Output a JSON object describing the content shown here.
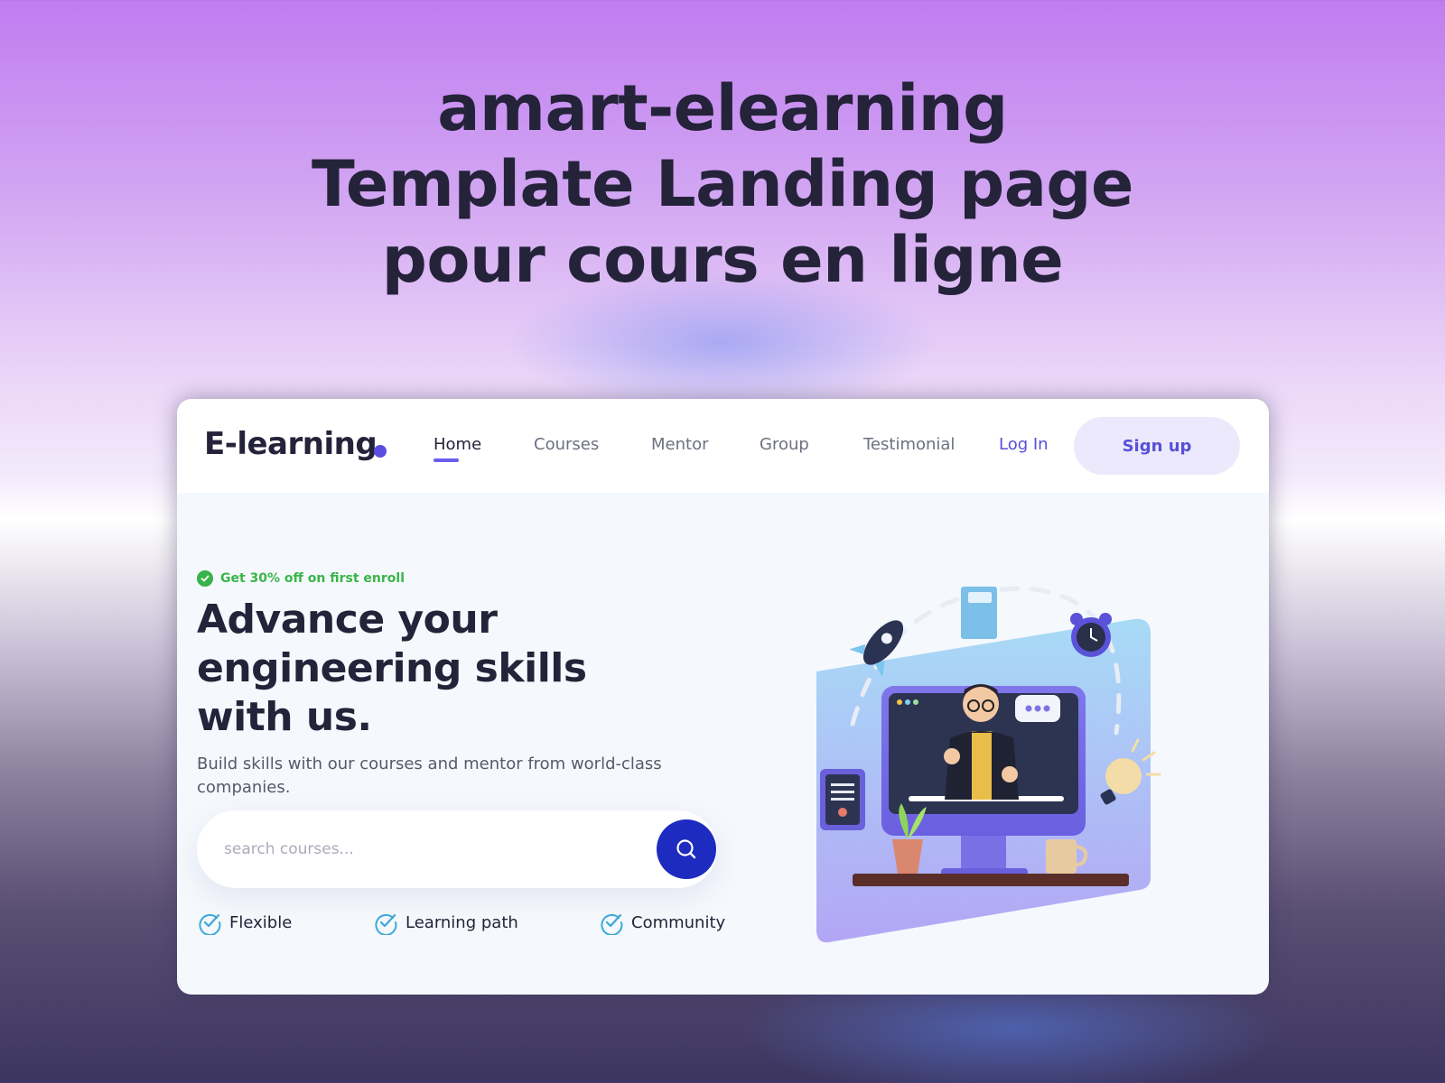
{
  "promo": {
    "headline_lines": [
      "amart-elearning",
      "Template Landing page",
      "pour cours en ligne"
    ]
  },
  "site": {
    "logo_text": "E-learning",
    "nav": [
      {
        "label": "Home",
        "active": true
      },
      {
        "label": "Courses",
        "active": false
      },
      {
        "label": "Mentor",
        "active": false
      },
      {
        "label": "Group",
        "active": false
      },
      {
        "label": "Testimonial",
        "active": false
      }
    ],
    "login_label": "Log In",
    "signup_label": "Sign up"
  },
  "hero": {
    "badge_text": "Get 30% off on first enroll",
    "title": "Advance your engineering skills with us.",
    "subtitle": "Build skills with our courses and mentor from world-class companies.",
    "search": {
      "placeholder": "search courses...",
      "value": ""
    },
    "features": [
      "Flexible",
      "Learning path",
      "Community"
    ]
  },
  "colors": {
    "accent": "#5a4ee0",
    "search_button": "#1e2bc0",
    "badge_green": "#3ab54a",
    "feature_check": "#3aa9d8",
    "heading": "#24233a"
  },
  "icons": {
    "search_button": "search-icon",
    "badge": "verified-badge-icon",
    "features": "check-circle-icon"
  }
}
